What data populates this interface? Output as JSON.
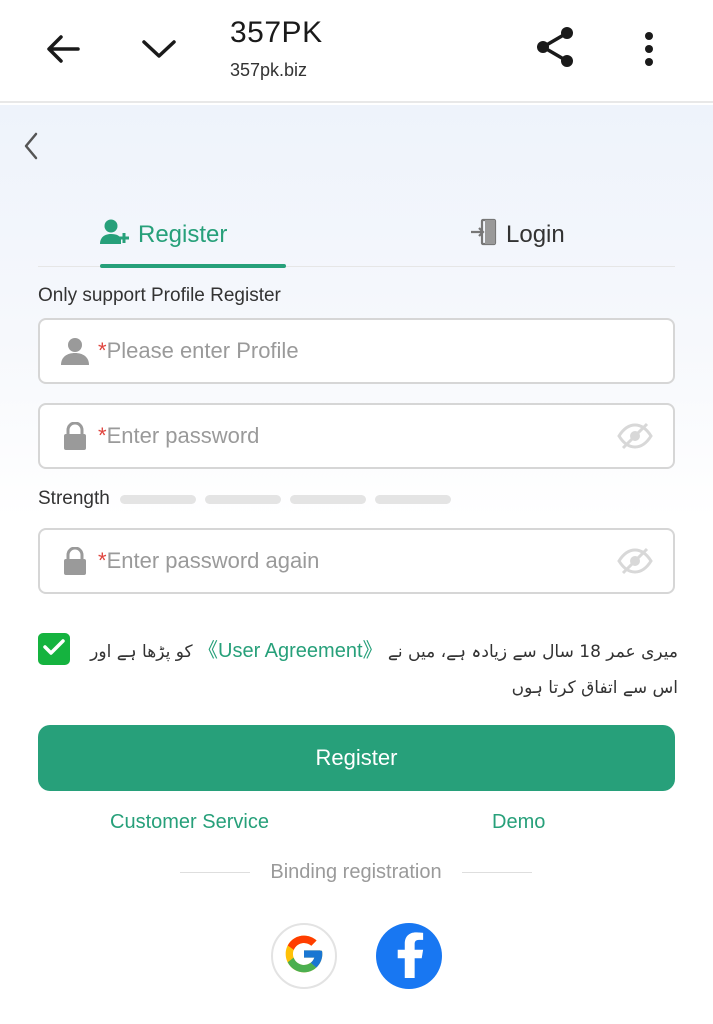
{
  "browser": {
    "title": "357PK",
    "url": "357pk.biz",
    "icons": [
      "back-arrow-icon",
      "chevron-down-icon",
      "share-icon",
      "more-vertical-icon"
    ]
  },
  "tabs": [
    {
      "label": "Register",
      "icon": "add-user-icon",
      "active": true
    },
    {
      "label": "Login",
      "icon": "login-door-icon",
      "active": false
    }
  ],
  "form": {
    "hint": "Only support Profile Register",
    "required_mark": "*",
    "profile_placeholder": "Please enter Profile",
    "password_placeholder": "Enter password",
    "password_again_placeholder": "Enter password again",
    "strength_label": "Strength",
    "strength_level": 0
  },
  "agreement": {
    "checked": true,
    "text_before": "میری عمر 18 سال سے زیادہ ہے، میں نے",
    "link": "《User Agreement》",
    "text_after": "کو پڑھا ہے اور اس سے اتفاق کرتا ہوں"
  },
  "actions": {
    "register_button": "Register",
    "customer_service": "Customer Service",
    "demo": "Demo",
    "binding_label": "Binding registration"
  },
  "social": [
    "google-icon",
    "facebook-icon"
  ],
  "colors": {
    "accent": "#27a07a",
    "checkbox": "#15b33f",
    "required": "#e0443e",
    "facebook": "#1877f2"
  }
}
